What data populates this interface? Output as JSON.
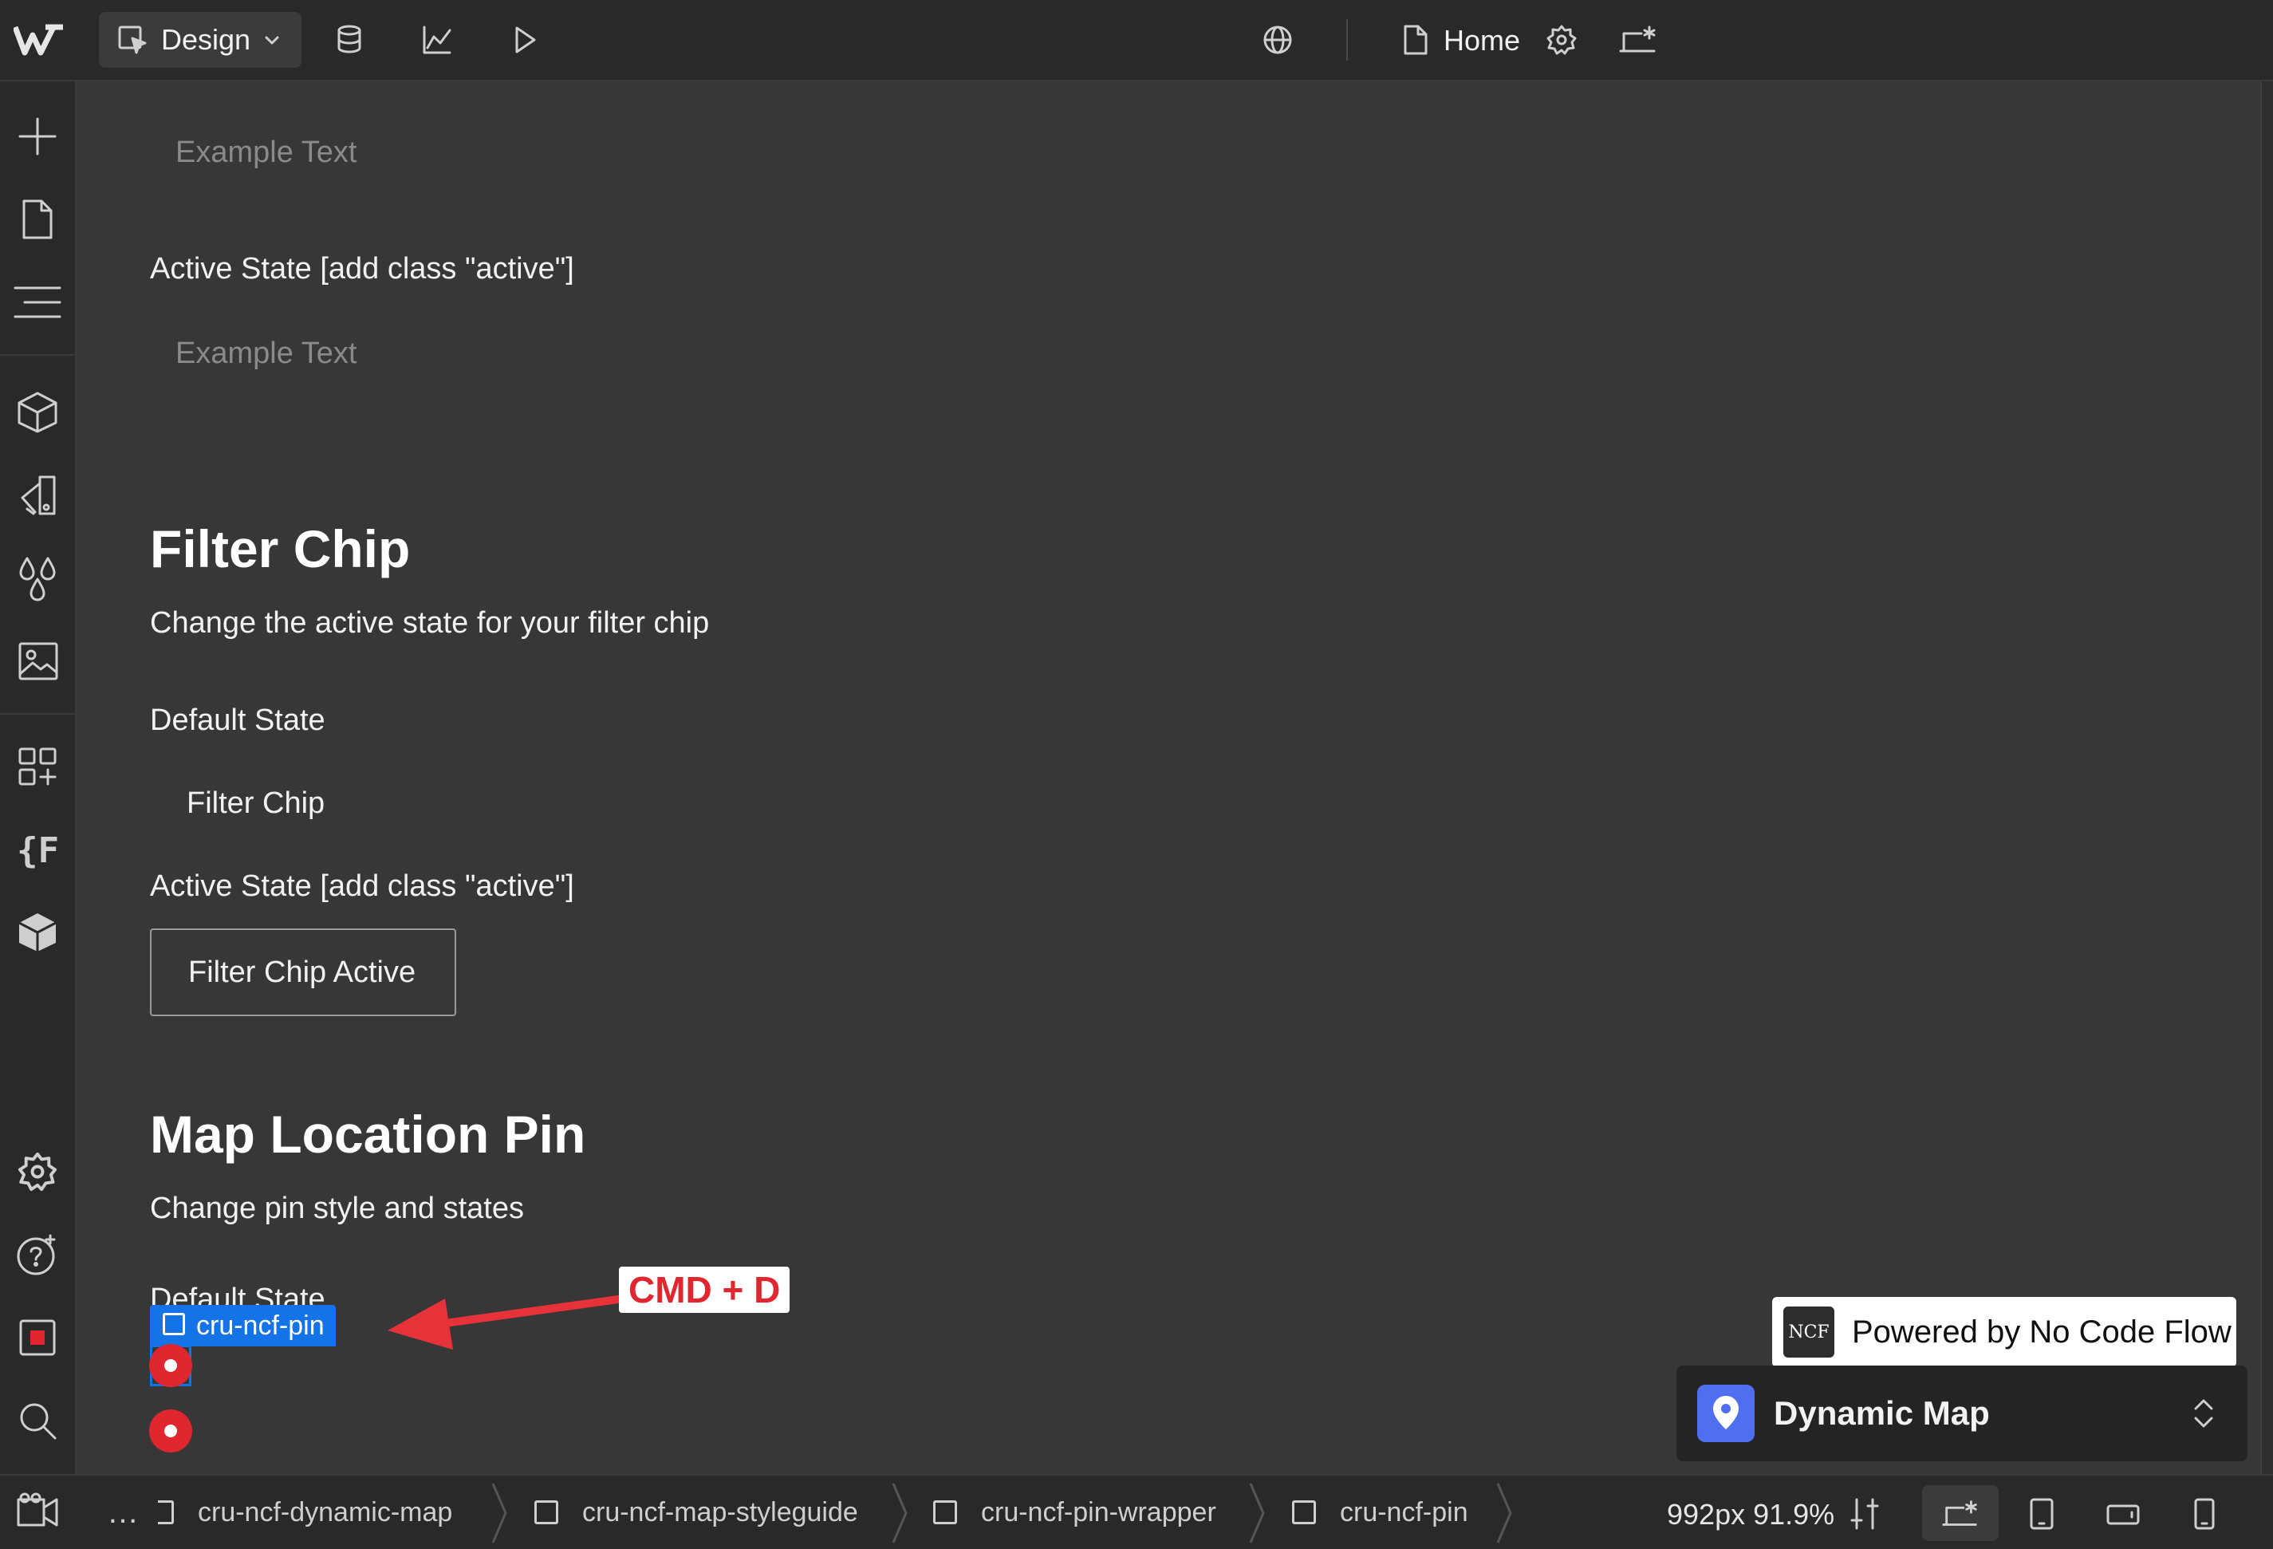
{
  "topbar": {
    "mode_label": "Design",
    "page_name": "Home",
    "icons": [
      "webflow-logo",
      "cursor-select-icon",
      "chevron-down-icon",
      "database-icon",
      "analytics-icon",
      "play-icon",
      "globe-icon",
      "page-icon",
      "settings-icon",
      "breakpoint-icon"
    ]
  },
  "sidebar": {
    "items": [
      "add-icon",
      "pages-icon",
      "navigator-icon",
      "components-icon",
      "style-manager-icon",
      "variables-icon",
      "assets-icon",
      "apps-icon",
      "finsweet-icon",
      "box-icon",
      "settings-icon",
      "help-icon",
      "record-icon",
      "search-icon",
      "video-icon"
    ]
  },
  "canvas": {
    "example_text_1": "Example Text",
    "active_state_1": "Active State [add class \"active\"]",
    "example_text_2": "Example Text",
    "filter_chip": {
      "heading": "Filter Chip",
      "subtitle": "Change the active state for your filter chip",
      "default_label": "Default State",
      "chip_default": "Filter Chip",
      "active_label": "Active State [add class \"active\"]",
      "chip_active": "Filter Chip Active"
    },
    "map_pin": {
      "heading": "Map Location Pin",
      "subtitle": "Change pin style and states",
      "default_label": "Default State",
      "selected_element": "cru-ncf-pin",
      "shortcut_annotation": "CMD + D"
    }
  },
  "ncf_panel": {
    "logo_text": "NCF",
    "powered_by": "Powered by No Code Flow",
    "title": "Dynamic Map"
  },
  "bottombar": {
    "more_label": "…",
    "breadcrumbs": [
      "cru-ncf-dynamic-map",
      "cru-ncf-map-styleguide",
      "cru-ncf-pin-wrapper",
      "cru-ncf-pin"
    ],
    "width_readout": "992px",
    "zoom_readout": "91.9%"
  },
  "colors": {
    "accent": "#1473e6",
    "pin": "#e0262e",
    "ncf_map_icon": "#4f6ff0"
  }
}
